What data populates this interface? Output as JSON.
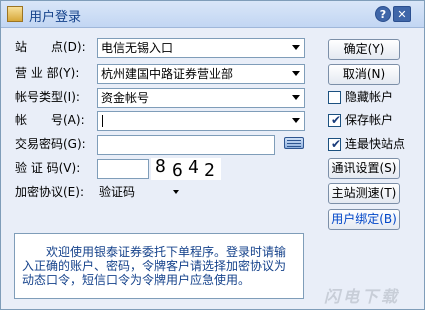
{
  "window": {
    "title": "用户登录",
    "help_label": "?",
    "close_label": "✕"
  },
  "form": {
    "station": {
      "label": "站　　点(D):",
      "value": "电信无锡入口"
    },
    "branch": {
      "label": "营 业 部(Y):",
      "value": "杭州建国中路证券营业部"
    },
    "account_type": {
      "label": "帐号类型(I):",
      "value": "资金帐号"
    },
    "account": {
      "label": "帐　　号(A):",
      "value": ""
    },
    "trade_password": {
      "label": "交易密码(G):",
      "value": ""
    },
    "captcha": {
      "label": "验 证 码(V):",
      "value": "",
      "code": [
        "8",
        "6",
        "4",
        "2"
      ]
    },
    "encryption": {
      "label": "加密协议(E):",
      "value": "验证码"
    }
  },
  "buttons": {
    "confirm": "确定(Y)",
    "cancel": "取消(N)",
    "comm_settings": "通讯设置(S)",
    "speed_test": "主站测速(T)",
    "bind_user": "用户绑定(B)"
  },
  "options": {
    "hide_account": {
      "label": "隐藏帐户",
      "checked": false
    },
    "save_account": {
      "label": "保存帐户",
      "checked": true
    },
    "fastest_station": {
      "label": "连最快站点",
      "checked": true
    }
  },
  "notice": "欢迎使用银泰证券委托下单程序。登录时请输入正确的账户、密码，令牌客户请选择加密协议为动态口令，短信口令为令牌用户应急使用。",
  "watermark": "闪电下载",
  "icons": {
    "app": "app-icon",
    "help": "help-icon",
    "close": "close-icon",
    "keyboard": "keyboard-icon"
  },
  "colors": {
    "title_text": "#15428b",
    "bind_button_text": "#0046c8",
    "window_bg": "#e9eef8"
  }
}
